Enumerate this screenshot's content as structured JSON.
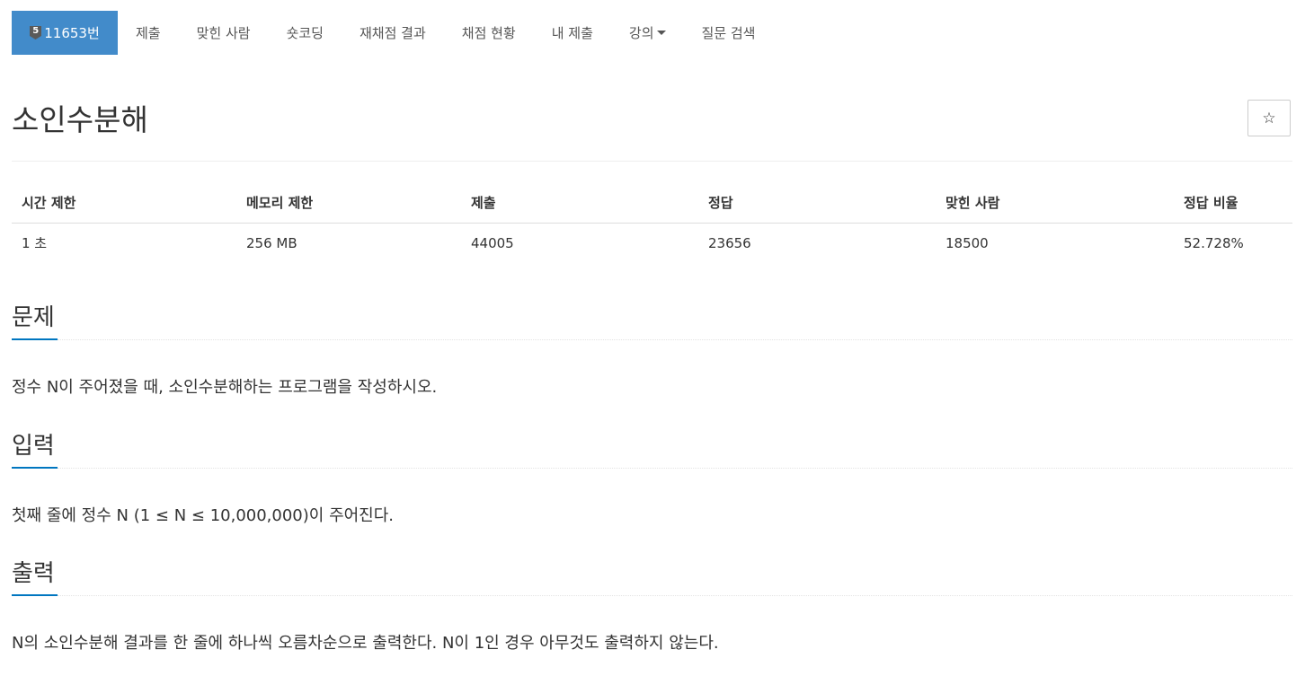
{
  "nav": {
    "problem_tab": {
      "tier_num": "5",
      "label": "11653번"
    },
    "items": [
      "제출",
      "맞힌 사람",
      "숏코딩",
      "재채점 결과",
      "채점 현황",
      "내 제출",
      "강의",
      "질문 검색"
    ]
  },
  "problem": {
    "title": "소인수분해",
    "star_icon": "☆"
  },
  "info_table": {
    "headers": [
      "시간 제한",
      "메모리 제한",
      "제출",
      "정답",
      "맞힌 사람",
      "정답 비율"
    ],
    "values": [
      "1 초",
      "256 MB",
      "44005",
      "23656",
      "18500",
      "52.728%"
    ]
  },
  "sections": {
    "description": {
      "heading": "문제",
      "text": "정수 N이 주어졌을 때, 소인수분해하는 프로그램을 작성하시오."
    },
    "input": {
      "heading": "입력",
      "text": "첫째 줄에 정수 N (1 ≤ N ≤ 10,000,000)이 주어진다."
    },
    "output": {
      "heading": "출력",
      "text": "N의 소인수분해 결과를 한 줄에 하나씩 오름차순으로 출력한다. N이 1인 경우 아무것도 출력하지 않는다."
    }
  },
  "colors": {
    "active_tab": "#428bca",
    "section_accent": "#0076c0",
    "tier_badge": "#5a5a5a"
  }
}
